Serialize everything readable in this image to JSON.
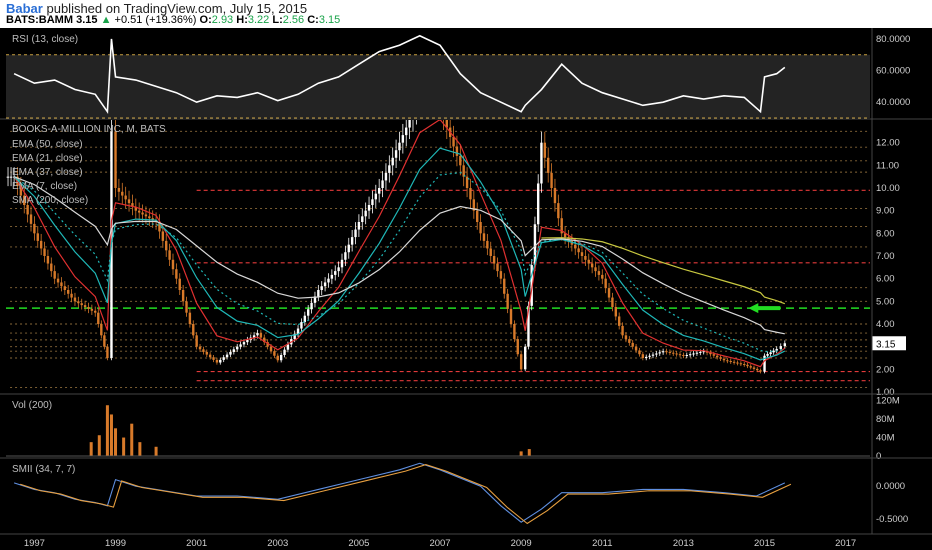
{
  "header": {
    "author": "Babar",
    "published": "published on TradingView.com, July 15, 2015",
    "symbol": "BATS:BAMM",
    "price": "3.15",
    "change_arrow": "▲",
    "change": "+0.51 (+19.36%)",
    "open_label": "O:",
    "open": "2.93",
    "high_label": "H:",
    "high": "3.22",
    "low_label": "L:",
    "low": "2.56",
    "close_label": "C:",
    "close": "3.15"
  },
  "colors": {
    "background": "#000000",
    "candle_up": "#ffffff",
    "candle_down": "#d87a2a",
    "ema_red": "#e03030",
    "ema_teal": "#1fb7b7",
    "sma_white": "#d8d8d8",
    "sma200": "#c8c840",
    "green_level": "#22dd22",
    "red_level": "#e23a3a"
  },
  "chart_data": [
    {
      "type": "line",
      "panel": "rsi",
      "title": "RSI (13, close)",
      "yaxis_ticks": [
        "80.0000",
        "60.0000",
        "40.0000"
      ],
      "ylim": [
        30,
        85
      ],
      "levels": [
        70,
        30
      ],
      "x": [
        1996.5,
        1997,
        1997.5,
        1998,
        1998.5,
        1998.8,
        1998.9,
        1999,
        1999.5,
        2000,
        2000.5,
        2001,
        2001.5,
        2002,
        2002.5,
        2003,
        2003.5,
        2004,
        2004.5,
        2005,
        2005.5,
        2006,
        2006.5,
        2007,
        2007.5,
        2008,
        2008.5,
        2009,
        2009.1,
        2009.5,
        2010,
        2010.5,
        2011,
        2011.5,
        2012,
        2012.5,
        2013,
        2013.5,
        2014,
        2014.5,
        2014.9,
        2015,
        2015.3,
        2015.5
      ],
      "values": [
        58,
        52,
        54,
        48,
        45,
        34,
        80,
        56,
        54,
        50,
        46,
        40,
        44,
        43,
        46,
        41,
        45,
        52,
        56,
        64,
        72,
        76,
        82,
        76,
        58,
        46,
        40,
        34,
        38,
        48,
        64,
        52,
        46,
        42,
        38,
        40,
        44,
        42,
        44,
        43,
        34,
        56,
        58,
        62
      ]
    },
    {
      "type": "candlestick",
      "panel": "price",
      "title": "BOOKS-A-MILLION INC, M, BATS",
      "legend": [
        "EMA (50, close)",
        "EMA (21, close)",
        "EMA (37, close)",
        "EMA (7, close)",
        "SMA (200, close)"
      ],
      "yaxis_ticks": [
        "12.00",
        "11.00",
        "10.00",
        "9.00",
        "8.00",
        "7.00",
        "6.00",
        "5.00",
        "4.00",
        "3.00",
        "2.00",
        "1.00"
      ],
      "ylim": [
        1.0,
        13.0
      ],
      "last_price": "3.15",
      "x": [
        1996.5,
        1997,
        1997.5,
        1998,
        1998.5,
        1998.8,
        1998.9,
        1999,
        1999.5,
        2000,
        2000.5,
        2001,
        2001.5,
        2002,
        2002.5,
        2003,
        2003.5,
        2004,
        2004.5,
        2005,
        2005.5,
        2006,
        2006.5,
        2007,
        2007.5,
        2008,
        2008.5,
        2009,
        2009.1,
        2009.5,
        2010,
        2010.5,
        2011,
        2011.5,
        2012,
        2012.5,
        2013,
        2013.5,
        2014,
        2014.5,
        2014.9,
        2015,
        2015.3,
        2015.5
      ],
      "close": [
        10.5,
        8,
        6,
        5,
        4.5,
        2.5,
        12.5,
        10,
        9,
        8.5,
        6,
        3,
        2.3,
        3,
        3.6,
        2.4,
        3.8,
        5.5,
        6.5,
        8.5,
        10,
        12,
        14,
        13.5,
        11,
        8,
        6,
        2,
        3,
        12,
        8,
        7,
        6,
        3.5,
        2.5,
        2.8,
        2.6,
        2.8,
        2.4,
        2.2,
        1.9,
        2.6,
        2.9,
        3.15
      ],
      "levels_green": [
        4.7
      ],
      "levels_red": [
        1.9,
        1.5,
        6.7,
        9.9
      ],
      "levels_other": [
        12.5,
        11.8,
        11.2,
        10.7,
        9.1,
        8.3,
        7.4,
        5.6,
        5.0,
        4.0,
        3.6,
        3.3,
        3.0,
        2.8,
        2.5,
        1.2
      ]
    },
    {
      "type": "bar",
      "panel": "volume",
      "title": "Vol (200)",
      "yaxis_ticks": [
        "120M",
        "80M",
        "40M",
        "0"
      ],
      "ylim": [
        0,
        130
      ],
      "x": [
        1998.4,
        1998.6,
        1998.8,
        1998.9,
        1999,
        1999.2,
        1999.4,
        1999.6,
        2000,
        2009,
        2009.2
      ],
      "values": [
        30,
        45,
        110,
        90,
        60,
        40,
        70,
        30,
        20,
        10,
        15
      ]
    },
    {
      "type": "line",
      "panel": "smii",
      "title": "SMII (34, 7, 7)",
      "yaxis_ticks": [
        "0.0000",
        "-0.5000"
      ],
      "ylim": [
        -0.7,
        0.4
      ],
      "x": [
        1996.5,
        1997,
        1997.5,
        1998,
        1998.5,
        1998.8,
        1999,
        1999.5,
        2000,
        2001,
        2002,
        2003,
        2004,
        2005,
        2006,
        2006.5,
        2007,
        2008,
        2008.5,
        2009,
        2009.5,
        2010,
        2011,
        2012,
        2013,
        2014,
        2014.8,
        2015.5
      ],
      "values": [
        0.05,
        -0.05,
        -0.1,
        -0.2,
        -0.25,
        -0.3,
        0.1,
        0.0,
        -0.05,
        -0.15,
        -0.15,
        -0.2,
        -0.05,
        0.1,
        0.25,
        0.35,
        0.25,
        0.0,
        -0.3,
        -0.55,
        -0.35,
        -0.1,
        -0.1,
        -0.05,
        -0.05,
        -0.1,
        -0.15,
        0.05
      ]
    }
  ],
  "xaxis_ticks": [
    "1997",
    "1999",
    "2001",
    "2003",
    "2005",
    "2007",
    "2009",
    "2011",
    "2013",
    "2015",
    "2017"
  ]
}
